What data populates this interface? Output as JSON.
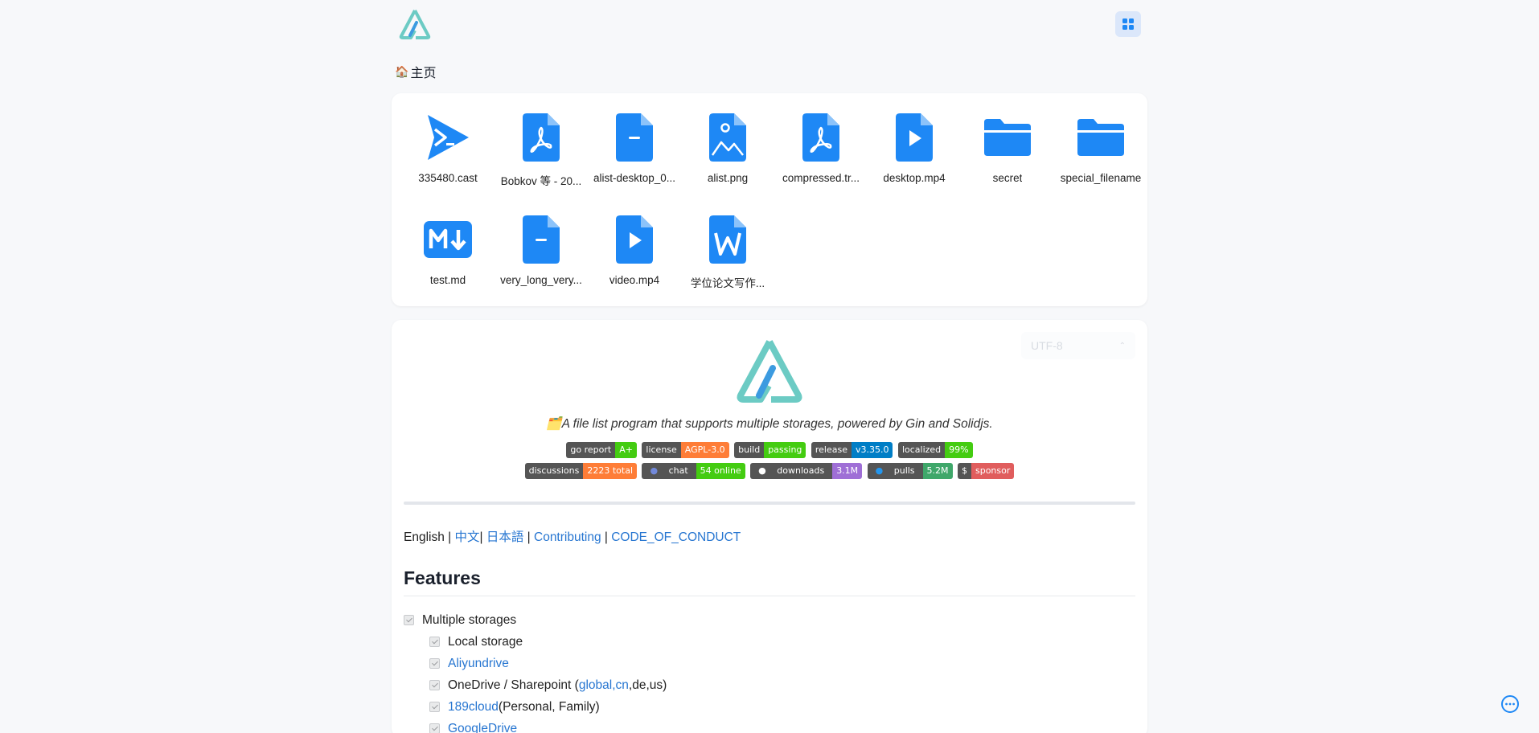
{
  "header": {
    "logo": "alist-logo",
    "layout_toggle_icon": "grid-icon"
  },
  "breadcrumb": {
    "home_emoji": "🏠",
    "home_label": "主页"
  },
  "files": [
    {
      "name": "335480.cast",
      "icon": "cast-play-icon"
    },
    {
      "name": "Bobkov 等 - 20...",
      "icon": "pdf-file-icon"
    },
    {
      "name": "alist-desktop_0...",
      "icon": "generic-file-icon"
    },
    {
      "name": "alist.png",
      "icon": "image-file-icon"
    },
    {
      "name": "compressed.tr...",
      "icon": "pdf-file-icon"
    },
    {
      "name": "desktop.mp4",
      "icon": "video-file-icon"
    },
    {
      "name": "secret",
      "icon": "folder-icon"
    },
    {
      "name": "special_filename",
      "icon": "folder-icon"
    },
    {
      "name": "test.md",
      "icon": "markdown-icon"
    },
    {
      "name": "very_long_very...",
      "icon": "generic-file-icon"
    },
    {
      "name": "video.mp4",
      "icon": "video-file-icon"
    },
    {
      "name": "学位论文写作...",
      "icon": "word-file-icon"
    }
  ],
  "readme": {
    "encoding": "UTF-8",
    "tagline_emoji": "🗂️",
    "tagline": "A file list program that supports multiple storages, powered by Gin and Solidjs.",
    "badges_row1": [
      {
        "label": "go report",
        "value": "A+",
        "color": "#4c1"
      },
      {
        "label": "license",
        "value": "AGPL-3.0",
        "color": "#fe7d37"
      },
      {
        "label": "build",
        "value": "passing",
        "color": "#4c1"
      },
      {
        "label": "release",
        "value": "v3.35.0",
        "color": "#007ec6"
      },
      {
        "label": "localized",
        "value": "99%",
        "color": "#4c1"
      }
    ],
    "badges_row2": [
      {
        "label": "discussions",
        "value": "2223 total",
        "color": "#fe7d37"
      },
      {
        "label": "chat",
        "value": "54 online",
        "color": "#4c1"
      },
      {
        "label": "downloads",
        "value": "3.1M",
        "color": "#9f6fd6"
      },
      {
        "label": "pulls",
        "value": "5.2M",
        "color": "#3fa76a"
      },
      {
        "label": "$",
        "value": "sponsor",
        "color": "#e05d5d"
      }
    ],
    "lang_english": "English",
    "sep1": " | ",
    "lang_chinese": "中文",
    "sep2": "| ",
    "lang_japanese": "日本語",
    "sep3": " | ",
    "contributing": "Contributing",
    "sep4": " | ",
    "code_of_conduct": "CODE_OF_CONDUCT",
    "features_heading": "Features",
    "features": {
      "multiple_storages": "Multiple storages",
      "local_storage": "Local storage",
      "aliyundrive": "Aliyundrive",
      "onedrive_prefix": "OneDrive / Sharepoint (",
      "onedrive_global": "global",
      "onedrive_comma1": ", ",
      "onedrive_cn": "cn",
      "onedrive_suffix": ",de,us)",
      "cloud189": "189cloud",
      "cloud189_suffix": " (Personal, Family)",
      "googledrive": "GoogleDrive"
    }
  },
  "chat_fab_icon": "chat-bubble-icon"
}
